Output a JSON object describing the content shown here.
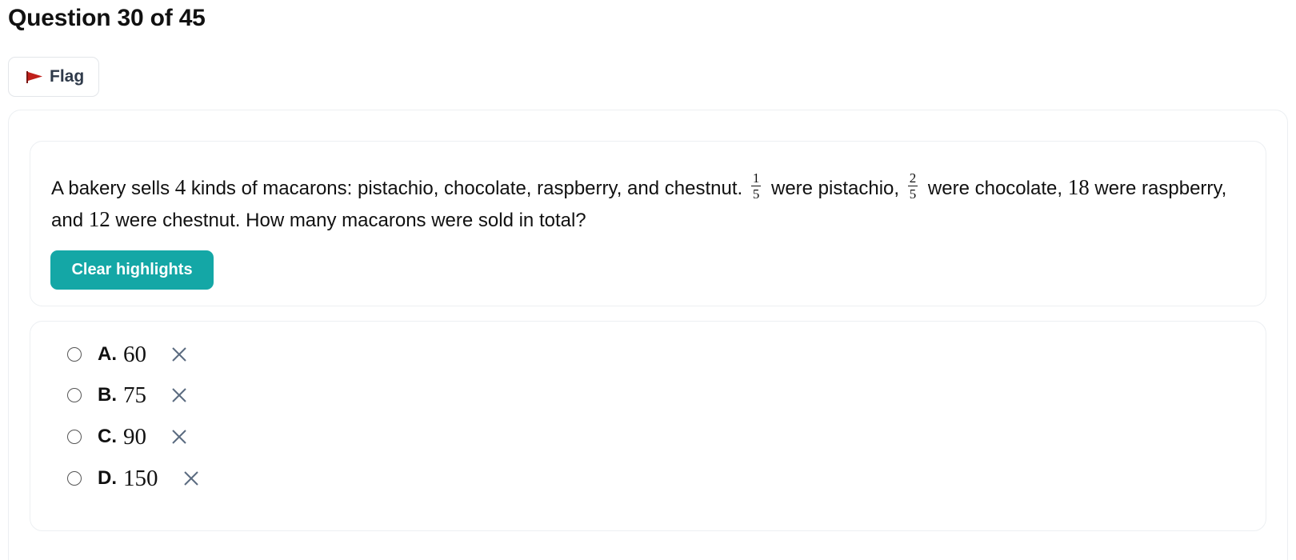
{
  "header": {
    "title": "Question 30 of 45",
    "flag_label": "Flag"
  },
  "question": {
    "text_1": "A bakery sells ",
    "num_kinds": "4",
    "text_2": " kinds of macarons: pistachio, chocolate, raspberry, and chestnut. ",
    "frac1_num": "1",
    "frac1_den": "5",
    "text_3": " were pistachio, ",
    "frac2_num": "2",
    "frac2_den": "5",
    "text_4": " were chocolate, ",
    "num_raspberry": "18",
    "text_5": " were raspberry, and ",
    "num_chestnut": "12",
    "text_6": " were chestnut. How many macarons were sold in total?",
    "clear_label": "Clear highlights"
  },
  "choices": [
    {
      "letter": "A.",
      "value": "60"
    },
    {
      "letter": "B.",
      "value": "75"
    },
    {
      "letter": "C.",
      "value": "90"
    },
    {
      "letter": "D.",
      "value": "150"
    }
  ],
  "colors": {
    "accent": "#14a7a6",
    "flag": "#c0201b",
    "eliminate_icon": "#5b6b80"
  },
  "icons": {
    "flag": "flag-icon",
    "eliminate": "close-icon"
  }
}
